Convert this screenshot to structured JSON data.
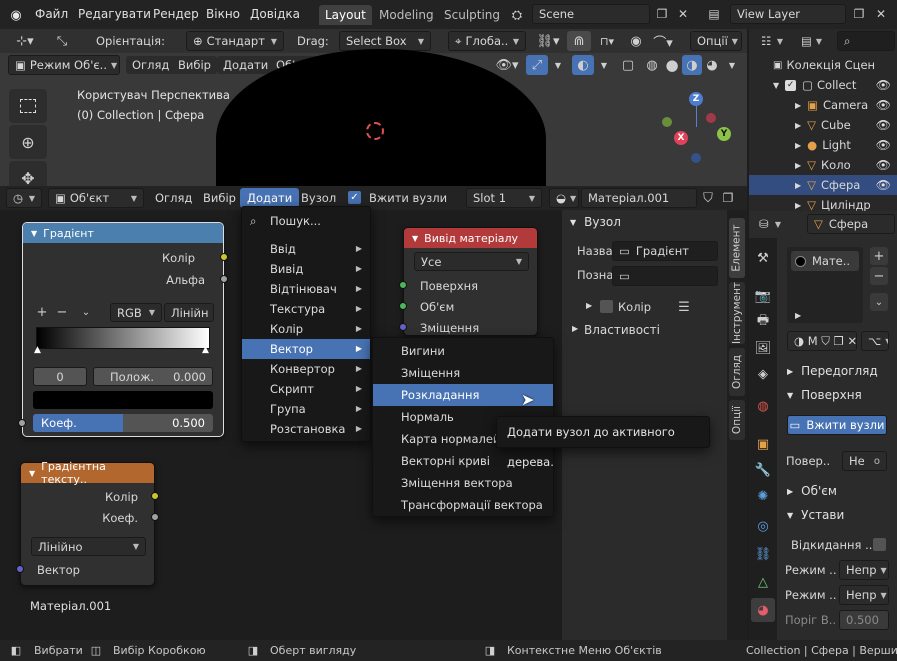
{
  "topbar": {
    "menus": [
      "Файл",
      "Редагувати",
      "Рендер",
      "Вікно",
      "Довідка"
    ],
    "workspaces": [
      "Layout",
      "Modeling",
      "Sculpting"
    ],
    "scene": "Scene",
    "view_layer": "View Layer"
  },
  "viewport_header": {
    "orientation_label": "Орієнтація:",
    "orientation": "Стандарт",
    "drag_label": "Drag:",
    "drag": "Select Box",
    "transform": "Глоба..",
    "options": "Опції",
    "mode": "Режим Об'є..",
    "menus": [
      "Огляд",
      "Вибір",
      "Додати",
      "Об'єкт"
    ]
  },
  "viewport": {
    "line1": "Користувач Перспектива",
    "line2": "(0) Collection | Сфера",
    "gizmo": {
      "z": "Z",
      "y": "Y",
      "x": "X"
    }
  },
  "node_header": {
    "type": "Об'єкт",
    "menus": [
      "Огляд",
      "Вибір",
      "Додати",
      "Вузол"
    ],
    "use_nodes": "Вжити вузли",
    "slot": "Slot 1",
    "material": "Матеріал.001"
  },
  "nodes": {
    "gradient": {
      "title": "Градієнт",
      "out1": "Колір",
      "out2": "Альфа",
      "mode": "RGB",
      "interp": "Лінійн",
      "index": "0",
      "pos_label": "Полож.",
      "pos": "0.000",
      "fac_label": "Коеф.",
      "fac": "0.500",
      "fac_fraction": 0.5
    },
    "gradtex": {
      "title": "Градієнтна тексту..",
      "out1": "Колір",
      "out2": "Коеф.",
      "type": "Лінійно",
      "in1": "Вектор"
    },
    "output": {
      "title": "Вивід матеріалу",
      "target": "Усе",
      "in1": "Поверхня",
      "in2": "Об'єм",
      "in3": "Зміщення"
    },
    "material_label": "Матеріал.001"
  },
  "add_menu": {
    "search": "Пошук...",
    "items": [
      "Ввід",
      "Вивід",
      "Відтінювач",
      "Текстура",
      "Колір",
      "Вектор",
      "Конвертор",
      "Скрипт",
      "Група",
      "Розстановка"
    ],
    "highlighted": "Вектор"
  },
  "vector_menu": {
    "items": [
      "Вигини",
      "Зміщення",
      "Розкладання",
      "Нормаль",
      "Карта нормалей",
      "Векторні криві",
      "Зміщення вектора",
      "Трансформації вектора"
    ],
    "highlighted": "Розкладання"
  },
  "tooltip": "Додати вузол до активного дерева.",
  "npanel": {
    "section": "Вузол",
    "name_label": "Назва",
    "name": "Градієнт",
    "label_label": "Позна",
    "color": "Колір",
    "props": "Властивості",
    "tabs": [
      "Елемент",
      "Інструмент",
      "Огляд",
      "Опції"
    ]
  },
  "outliner": {
    "rows": [
      "Колекція Сцен",
      "Collect",
      "Camera",
      "Cube",
      "Light",
      "Коло",
      "Сфера",
      "Циліндр"
    ]
  },
  "props": {
    "object": "Сфера",
    "mat_slot": "Мате..",
    "preview": "Передогляд",
    "surface": "Поверхня",
    "use_nodes": "Вжити вузли",
    "surf_label": "Повер..",
    "surf_val": "Не",
    "volume": "Об'єм",
    "settings": "Устави",
    "backface": "Відкидання ..",
    "mode1_label": "Режим ..",
    "mode1": "Непр",
    "mode2_label": "Режим ..",
    "mode2": "Непр",
    "thresh_label": "Поріг В..",
    "thresh": "0.500"
  },
  "status": {
    "select": "Вибрати",
    "box": "Вибір Коробкою",
    "rotate": "Оберт вигляду",
    "context": "Контекстне Меню Об'єктів",
    "right": "Collection | Сфера | Вершини"
  }
}
